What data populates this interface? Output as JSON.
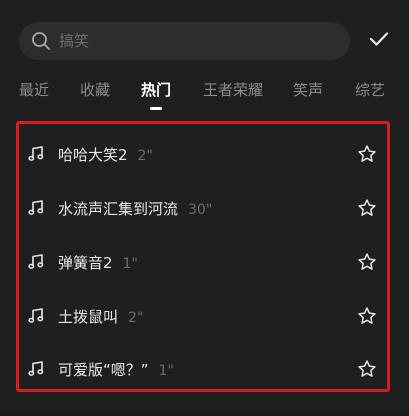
{
  "search": {
    "placeholder": "搞笑",
    "icon": "search-icon"
  },
  "confirm": {
    "icon": "check-icon"
  },
  "tabs": [
    {
      "label": "最近",
      "active": false
    },
    {
      "label": "收藏",
      "active": false
    },
    {
      "label": "热门",
      "active": true
    },
    {
      "label": "王者荣耀",
      "active": false
    },
    {
      "label": "笑声",
      "active": false
    },
    {
      "label": "综艺",
      "active": false
    }
  ],
  "sounds": [
    {
      "title": "哈哈大笑2",
      "duration": "2\"",
      "icon": "music-note-icon",
      "action_icon": "star-outline-icon"
    },
    {
      "title": "水流声汇集到河流",
      "duration": "30\"",
      "icon": "music-note-icon",
      "action_icon": "star-outline-icon"
    },
    {
      "title": "弹簧音2",
      "duration": "1\"",
      "icon": "music-note-icon",
      "action_icon": "star-outline-icon"
    },
    {
      "title": "土拨鼠叫",
      "duration": "2\"",
      "icon": "music-note-icon",
      "action_icon": "star-outline-icon"
    },
    {
      "title": "可爱版“嗯？”",
      "duration": "1\"",
      "icon": "music-note-icon",
      "action_icon": "star-outline-icon"
    }
  ],
  "colors": {
    "background": "#1f1f20",
    "search_bg": "#2d2d2f",
    "highlight_border": "#d1201e",
    "active_tab": "#ffffff",
    "inactive_tab": "#8b8b8f",
    "duration_text": "#6e6e72"
  }
}
